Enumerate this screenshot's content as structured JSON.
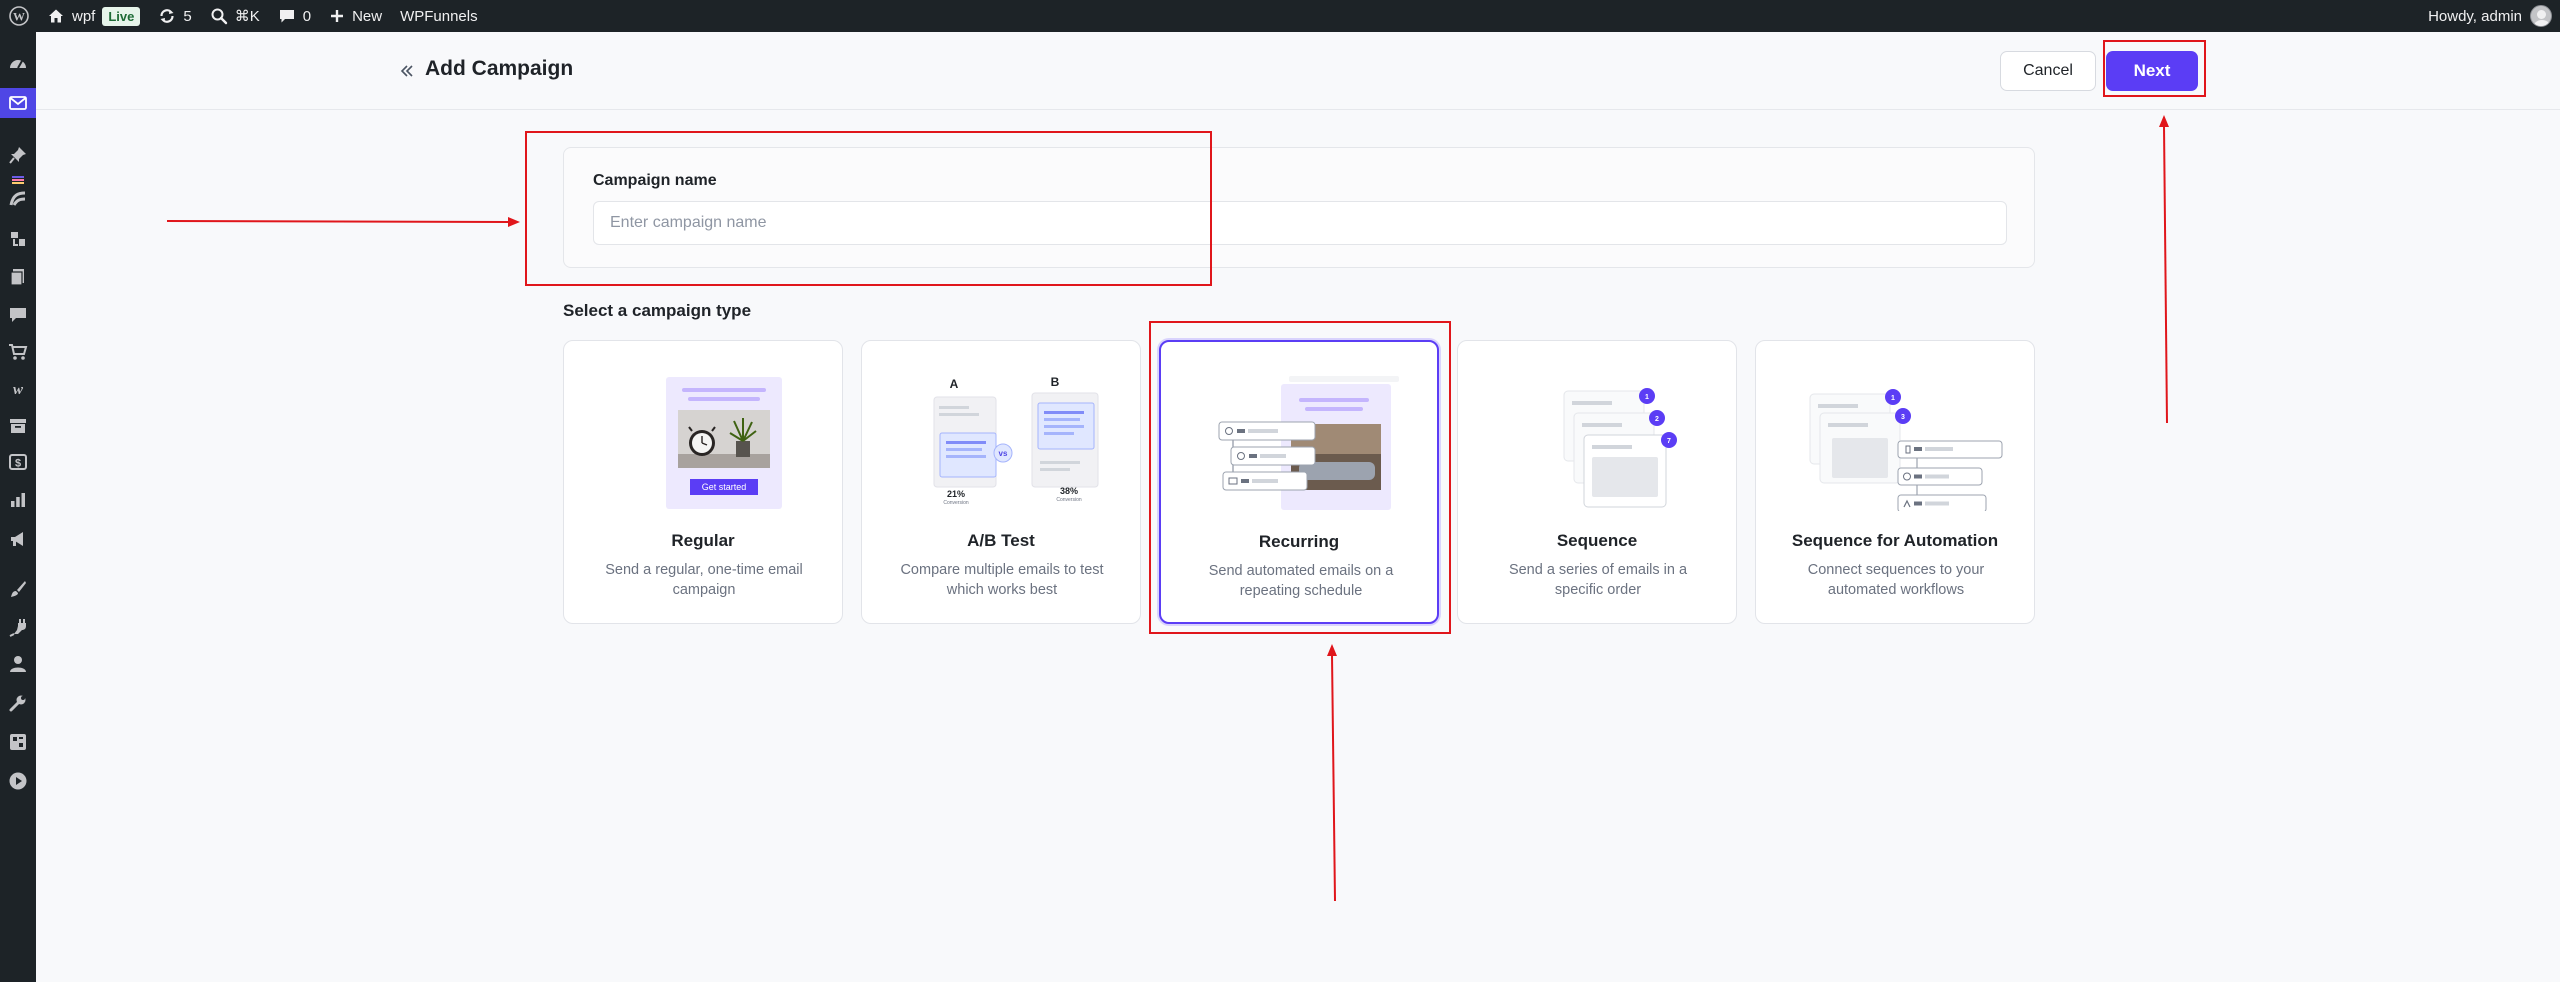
{
  "admin_bar": {
    "site_name": "wpf",
    "live_badge": "Live",
    "updates_count": "5",
    "search_shortcut": "⌘K",
    "comments_count": "0",
    "new_label": "New",
    "plugin_label": "WPFunnels",
    "greeting": "Howdy, admin"
  },
  "side_menu": {
    "icons": [
      "dashboard-icon",
      "mail-icon",
      "pin-icon",
      "plugin-logo-icon",
      "wave-icon",
      "funnel-icon",
      "pages-icon",
      "comments-icon",
      "cart-icon",
      "woo-icon",
      "archive-icon",
      "dollar-icon",
      "analytics-icon",
      "megaphone-icon",
      "brush-icon",
      "plugins-icon",
      "users-icon",
      "tools-icon",
      "settings-icon",
      "play-icon"
    ]
  },
  "header": {
    "title": "Add Campaign",
    "cancel_label": "Cancel",
    "next_label": "Next"
  },
  "campaign_name": {
    "label": "Campaign name",
    "placeholder": "Enter campaign name",
    "value": ""
  },
  "campaign_type": {
    "section_title": "Select a campaign type",
    "selected": "Recurring",
    "types": [
      {
        "name": "Regular",
        "description": "Send a regular, one-time email campaign",
        "illus_button": "Get started"
      },
      {
        "name": "A/B Test",
        "description": "Compare multiple emails to test which works best",
        "variant_a": "A",
        "variant_b": "B",
        "vs": "vs",
        "rate_a": "21%",
        "rate_b": "38%",
        "rate_caption": "Conversion"
      },
      {
        "name": "Recurring",
        "description": "Send automated emails on a repeating schedule"
      },
      {
        "name": "Sequence",
        "description": "Send a series of emails in a specific order",
        "steps": [
          "1",
          "2",
          "7"
        ]
      },
      {
        "name": "Sequence for Automation",
        "description": "Connect sequences to your automated workflows",
        "steps": [
          "1",
          "3"
        ]
      }
    ]
  },
  "colors": {
    "accent": "#5b3df5",
    "annotation": "#e0161b",
    "admin_bar": "#1d2327"
  }
}
